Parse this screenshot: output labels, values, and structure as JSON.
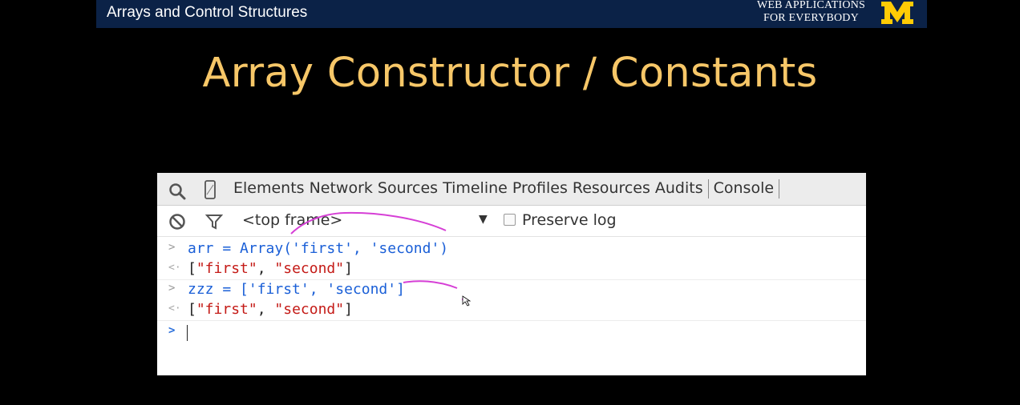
{
  "header": {
    "title": "Arrays and Control Structures",
    "brand_line1": "WEB APPLICATIONS",
    "brand_line2": "FOR EVERYBODY"
  },
  "slide": {
    "title": "Array Constructor / Constants"
  },
  "devtools": {
    "tabs": [
      {
        "label": "Elements"
      },
      {
        "label": "Network"
      },
      {
        "label": "Sources"
      },
      {
        "label": "Timeline"
      },
      {
        "label": "Profiles"
      },
      {
        "label": "Resources"
      },
      {
        "label": "Audits"
      },
      {
        "label": "Console"
      }
    ],
    "frame": "<top frame>",
    "preserve_log": "Preserve log"
  },
  "console": {
    "lines": [
      {
        "kind": "input",
        "prompt": ">",
        "parts": [
          "arr = Array(",
          "'first'",
          ", ",
          "'second'",
          ")"
        ]
      },
      {
        "kind": "output",
        "prompt": "<·",
        "parts": [
          "[",
          "\"first\"",
          ", ",
          "\"second\"",
          "]"
        ]
      },
      {
        "kind": "input",
        "prompt": ">",
        "parts": [
          "zzz = [",
          "'first'",
          ", ",
          "'second'",
          "]"
        ]
      },
      {
        "kind": "output",
        "prompt": "<·",
        "parts": [
          "[",
          "\"first\"",
          ", ",
          "\"second\"",
          "]"
        ]
      }
    ],
    "active_prompt": ">"
  },
  "colors": {
    "title": "#f7c768",
    "banner": "#0b2247",
    "logo": "#ffcb05",
    "annotation": "#d63fd6",
    "code_blue": "#1a5fd7",
    "string_red": "#c41a16"
  }
}
